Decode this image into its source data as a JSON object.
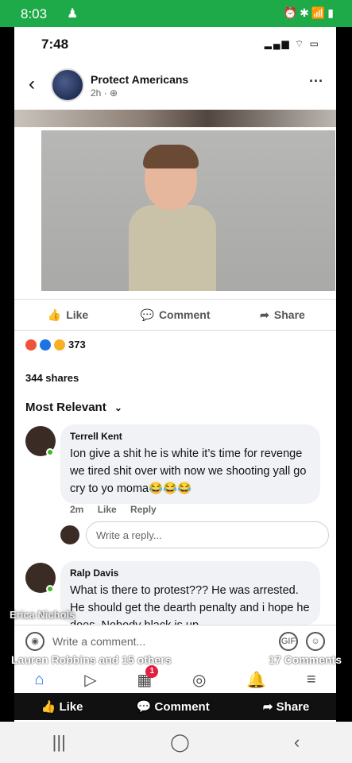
{
  "outer_status": {
    "time": "8:03"
  },
  "inner_status": {
    "time": "7:48"
  },
  "post": {
    "page_name": "Protect Americans",
    "meta": "2h · ⊕",
    "actions": {
      "like": "Like",
      "comment": "Comment",
      "share": "Share"
    },
    "reactions_count": "373",
    "shares": "344 shares",
    "sort_label": "Most Relevant"
  },
  "comments": [
    {
      "name": "Terrell Kent",
      "text": "Ion give a shit he is white it’s time for revenge we tired shit over with now we shooting yall go cry to yo moma😂😂😂",
      "time": "2m",
      "like": "Like",
      "reply": "Reply"
    },
    {
      "name": "Ralp Davis",
      "text": "What is there to protest??? He was arrested. He should get the dearth penalty and i hope he does. Nobody black is up"
    }
  ],
  "reply_placeholder": "Write a reply...",
  "overlay_name": "Erica Nichols",
  "comment_bar": {
    "placeholder": "Write a comment...",
    "gif": "GIF"
  },
  "reaction_summary": {
    "left": "Lauren Robbins and 15 others",
    "right": "17 Comments"
  },
  "nav": {
    "badge": "1"
  },
  "bottom_actions": {
    "like": "Like",
    "comment": "Comment",
    "share": "Share"
  },
  "colors": {
    "facebook_blue": "#1b74e4",
    "status_green": "#1faa4a"
  }
}
